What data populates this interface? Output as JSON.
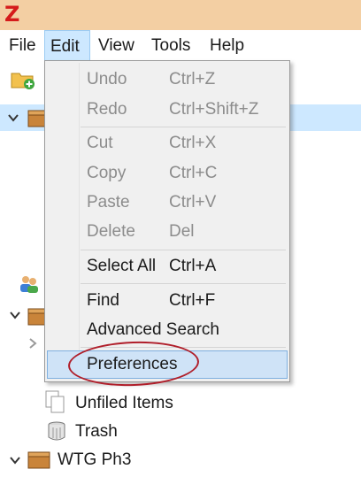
{
  "app": {
    "logo_letter": "Z",
    "titlebar_color": "#f3cfa3",
    "logo_color": "#d51b1b"
  },
  "menubar": {
    "items": [
      {
        "label": "File",
        "active": false
      },
      {
        "label": "Edit",
        "active": true
      },
      {
        "label": "View",
        "active": false
      },
      {
        "label": "Tools",
        "active": false
      },
      {
        "label": "Help",
        "active": false
      }
    ]
  },
  "toolbar": {
    "new_collection_icon": "folder-plus-icon"
  },
  "edit_menu": {
    "items": [
      {
        "label": "Undo",
        "shortcut": "Ctrl+Z",
        "enabled": false
      },
      {
        "label": "Redo",
        "shortcut": "Ctrl+Shift+Z",
        "enabled": false
      },
      {
        "label": "Cut",
        "shortcut": "Ctrl+X",
        "enabled": false
      },
      {
        "label": "Copy",
        "shortcut": "Ctrl+C",
        "enabled": false
      },
      {
        "label": "Paste",
        "shortcut": "Ctrl+V",
        "enabled": false
      },
      {
        "label": "Delete",
        "shortcut": "Del",
        "enabled": false
      },
      {
        "label": "Select All",
        "shortcut": "Ctrl+A",
        "enabled": true
      },
      {
        "label": "Find",
        "shortcut": "Ctrl+F",
        "enabled": true
      },
      {
        "label": "Advanced Search",
        "shortcut": "",
        "enabled": true
      },
      {
        "label": "Preferences",
        "shortcut": "",
        "enabled": true,
        "highlighted": true
      }
    ]
  },
  "tree": {
    "unfiled_label": "Unfiled Items",
    "trash_label": "Trash",
    "group_label": "WTG Ph3",
    "selection_color": "#cde8ff"
  },
  "annotation": {
    "circle_color": "#b01e2a"
  }
}
